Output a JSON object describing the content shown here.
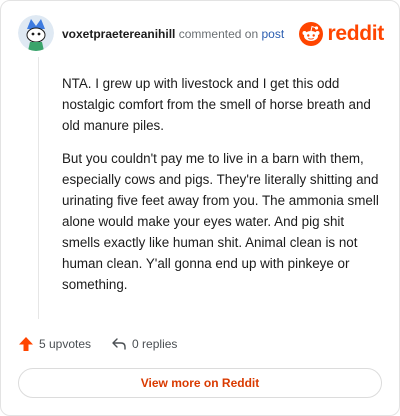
{
  "comment": {
    "username": "voxetpraetereanihill",
    "action_text": "commented on",
    "post_link": "post",
    "paragraphs": [
      "NTA. I grew up with livestock and I get this odd nostalgic comfort from the smell of horse breath and old manure piles.",
      "But you couldn't pay me to live in a barn with them, especially cows and pigs. They're literally shitting and urinating five feet away from you. The ammonia smell alone would make your eyes water. And pig shit smells exactly like human shit. Animal clean is not human clean. Y'all gonna end up with pinkeye or something."
    ],
    "upvotes": "5 upvotes",
    "replies": "0 replies"
  },
  "brand": {
    "wordmark": "reddit",
    "color": "#ff4500"
  },
  "footer": {
    "view_more_label": "View more on Reddit"
  },
  "icons": {
    "avatar": "snoo-avatar",
    "logo": "reddit-snoo-icon",
    "upvote": "upvote-arrow-icon",
    "reply": "reply-arrow-icon"
  }
}
